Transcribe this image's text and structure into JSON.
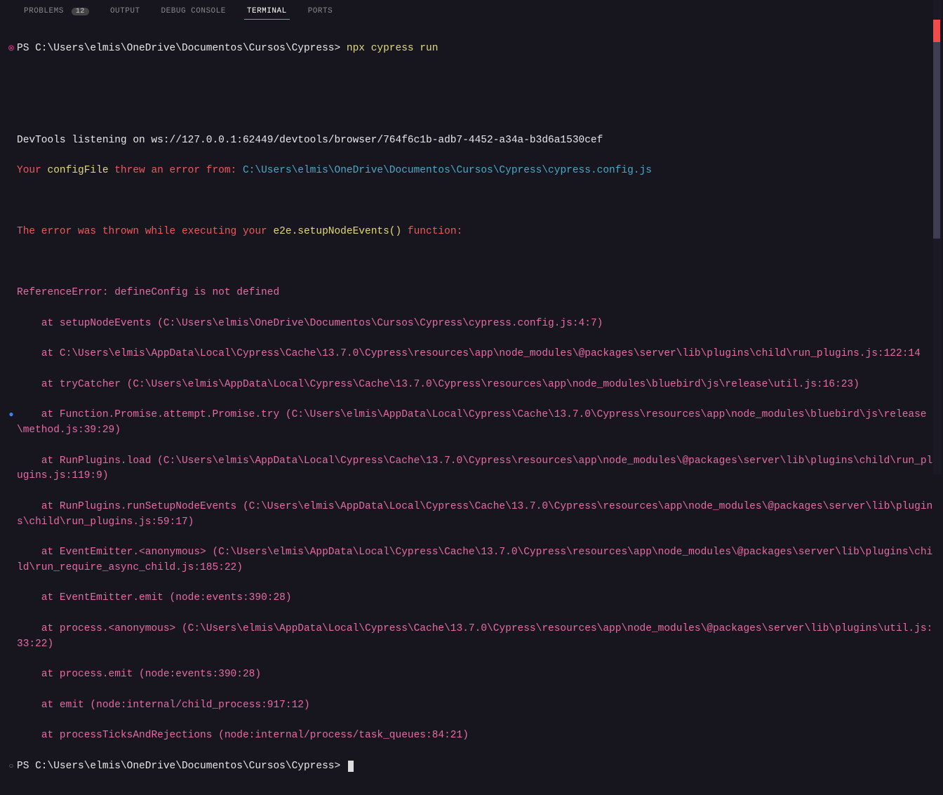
{
  "tabs": {
    "problems": "PROBLEMS",
    "problems_count": "12",
    "output": "OUTPUT",
    "debug": "DEBUG CONSOLE",
    "terminal": "TERMINAL",
    "ports": "PORTS"
  },
  "prompt1": {
    "prefix": "PS ",
    "path": "C:\\Users\\elmis\\OneDrive\\Documentos\\Cursos\\Cypress>",
    "cmd": " npx cypress run"
  },
  "devtools": "DevTools listening on ws://127.0.0.1:62449/devtools/browser/764f6c1b-adb7-4452-a34a-b3d6a1530cef",
  "cfg_err": {
    "a": "Your ",
    "b": "configFile",
    "c": " threw an error from: ",
    "d": "C:\\Users\\elmis\\OneDrive\\Documentos\\Cursos\\Cypress\\cypress.config.js"
  },
  "cfg_err2": {
    "a": "The error was thrown while executing your ",
    "b": "e2e.setupNodeEvents()",
    "c": " function:"
  },
  "st0": "ReferenceError: defineConfig is not defined",
  "st1": "    at setupNodeEvents (C:\\Users\\elmis\\OneDrive\\Documentos\\Cursos\\Cypress\\cypress.config.js:4:7)",
  "st2": "    at C:\\Users\\elmis\\AppData\\Local\\Cypress\\Cache\\13.7.0\\Cypress\\resources\\app\\node_modules\\@packages\\server\\lib\\plugins\\child\\run_plugins.js:122:14",
  "st3": "    at tryCatcher (C:\\Users\\elmis\\AppData\\Local\\Cypress\\Cache\\13.7.0\\Cypress\\resources\\app\\node_modules\\bluebird\\js\\release\\util.js:16:23)",
  "st4": "    at Function.Promise.attempt.Promise.try (C:\\Users\\elmis\\AppData\\Local\\Cypress\\Cache\\13.7.0\\Cypress\\resources\\app\\node_modules\\bluebird\\js\\release\\method.js:39:29)",
  "st5": "    at RunPlugins.load (C:\\Users\\elmis\\AppData\\Local\\Cypress\\Cache\\13.7.0\\Cypress\\resources\\app\\node_modules\\@packages\\server\\lib\\plugins\\child\\run_plugins.js:119:9)",
  "st6": "    at RunPlugins.runSetupNodeEvents (C:\\Users\\elmis\\AppData\\Local\\Cypress\\Cache\\13.7.0\\Cypress\\resources\\app\\node_modules\\@packages\\server\\lib\\plugins\\child\\run_plugins.js:59:17)",
  "st7": "    at EventEmitter.<anonymous> (C:\\Users\\elmis\\AppData\\Local\\Cypress\\Cache\\13.7.0\\Cypress\\resources\\app\\node_modules\\@packages\\server\\lib\\plugins\\child\\run_require_async_child.js:185:22)",
  "st8": "    at EventEmitter.emit (node:events:390:28)",
  "st9": "    at process.<anonymous> (C:\\Users\\elmis\\AppData\\Local\\Cypress\\Cache\\13.7.0\\Cypress\\resources\\app\\node_modules\\@packages\\server\\lib\\plugins\\util.js:33:22)",
  "st10": "    at process.emit (node:events:390:28)",
  "st11": "    at emit (node:internal/child_process:917:12)",
  "st12": "    at processTicksAndRejections (node:internal/process/task_queues:84:21)",
  "prompt2": {
    "prefix": "PS ",
    "path": "C:\\Users\\elmis\\OneDrive\\Documentos\\Cursos\\Cypress>"
  }
}
